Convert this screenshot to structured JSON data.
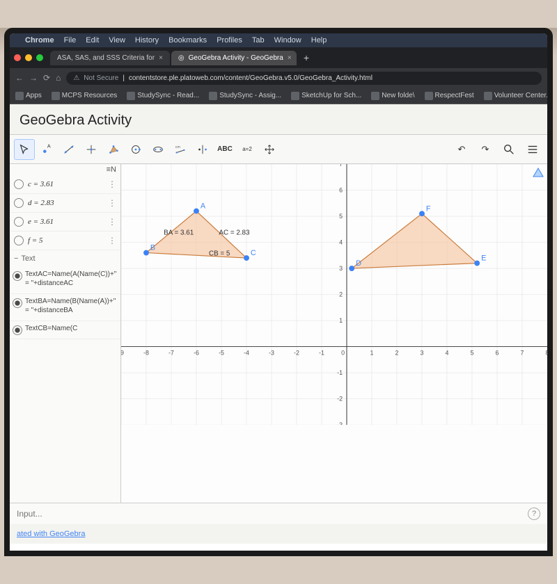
{
  "menubar": [
    "Chrome",
    "File",
    "Edit",
    "View",
    "History",
    "Bookmarks",
    "Profiles",
    "Tab",
    "Window",
    "Help"
  ],
  "tabs": [
    {
      "label": "ASA, SAS, and SSS Criteria for",
      "active": false
    },
    {
      "label": "GeoGebra Activity - GeoGebra",
      "active": true,
      "icon": "◎"
    }
  ],
  "url": {
    "secure_label": "Not Secure",
    "address": "contentstore.ple.platoweb.com/content/GeoGebra.v5.0/GeoGebra_Activity.html"
  },
  "bookmarks": [
    "Apps",
    "MCPS Resources",
    "StudySync - Read...",
    "StudySync - Assig...",
    "SketchUp for Sch...",
    "New folde\\",
    "RespectFest",
    "Volunteer Center..."
  ],
  "page_title": "GeoGebra Activity",
  "toolbar": {
    "tools": [
      "pointer",
      "point",
      "line",
      "perp",
      "poly",
      "circle",
      "arc",
      "angle",
      "slider",
      "text",
      "move"
    ],
    "text_label": "ABC",
    "slider_label": "a=2"
  },
  "algebra": {
    "en": "≡N",
    "items": [
      {
        "expr": "c = 3.61"
      },
      {
        "expr": "d = 2.83"
      },
      {
        "expr": "e = 3.61"
      },
      {
        "expr": "f = 5"
      }
    ],
    "section": "Text",
    "texts": [
      "TextAC=Name(A(Name(C))+\" = \"+distanceAC",
      "TextBA=Name(B(Name(A))+\" = \"+distanceBA",
      "TextCB=Name(C"
    ]
  },
  "input_placeholder": "Input...",
  "footer": "ated with GeoGebra",
  "chart_data": {
    "type": "scatter",
    "xlim": [
      -9,
      8
    ],
    "ylim": [
      -3,
      7
    ],
    "points": {
      "A": {
        "x": -6,
        "y": 5.2,
        "color": "#3b82f6"
      },
      "B": {
        "x": -8,
        "y": 3.6,
        "color": "#3b82f6"
      },
      "C": {
        "x": -4,
        "y": 3.4,
        "color": "#3b82f6"
      },
      "D": {
        "x": 0.2,
        "y": 3,
        "color": "#3b82f6"
      },
      "E": {
        "x": 5.2,
        "y": 3.2,
        "color": "#3b82f6"
      },
      "F": {
        "x": 3,
        "y": 5.1,
        "color": "#3b82f6"
      }
    },
    "triangles": [
      {
        "pts": [
          "A",
          "B",
          "C"
        ],
        "fill": "#f5c9a8"
      },
      {
        "pts": [
          "D",
          "E",
          "F"
        ],
        "fill": "#f5c9a8"
      }
    ],
    "labels": [
      {
        "text": "BA = 3.61",
        "x": -7.3,
        "y": 4.3
      },
      {
        "text": "AC = 2.83",
        "x": -5.1,
        "y": 4.3
      },
      {
        "text": "CB = 5",
        "x": -5.5,
        "y": 3.5
      }
    ]
  }
}
